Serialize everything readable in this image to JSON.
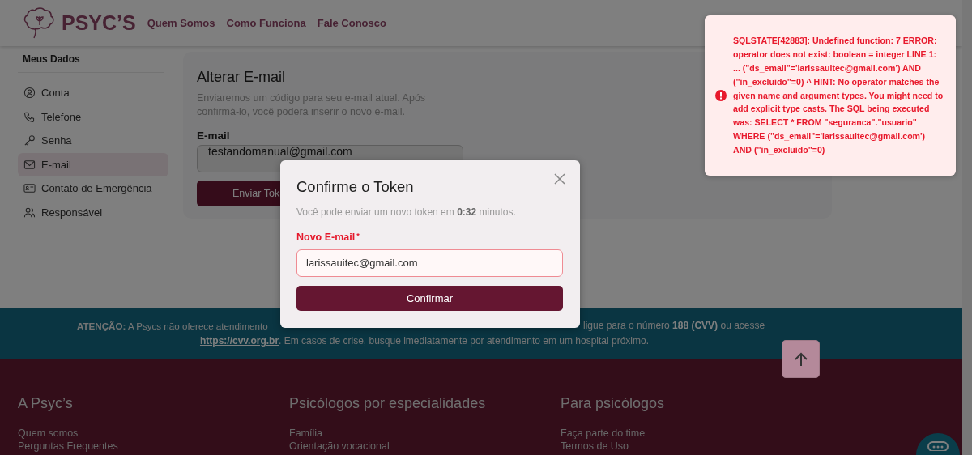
{
  "header": {
    "logo": "PSYC’S",
    "nav": [
      "Quem Somos",
      "Como Funciona",
      "Fale Conosco"
    ]
  },
  "sidebar": {
    "title": "Meus Dados",
    "items": [
      {
        "label": "Conta",
        "selected": false
      },
      {
        "label": "Telefone",
        "selected": false
      },
      {
        "label": "Senha",
        "selected": false
      },
      {
        "label": "E-mail",
        "selected": true
      },
      {
        "label": "Contato de Emergência",
        "selected": false
      },
      {
        "label": "Responsável",
        "selected": false
      }
    ]
  },
  "card": {
    "title": "Alterar E-mail",
    "description": "Enviaremos um código para seu e-mail atual. Após confirmá-lo, você poderá inserir o novo e-mail.",
    "field_label": "E-mail",
    "field_value": "testandomanual@gmail.com",
    "button": "Enviar Tok"
  },
  "attention": {
    "lead": "**ATENÇÃO:** A Psycs não oferece atendimento",
    "tail": "ligue para o número",
    "phone_link": "188 (CVV)",
    "tail_end": "ou acesse",
    "site_link": "https://cvv.org.br",
    "rest": ". Em casos de crise, busque imediatamente por atendimento em um hospital próximo."
  },
  "footer": {
    "columns": [
      {
        "title": "A Psyc’s",
        "links": [
          "Quem somos",
          "Perguntas Frequentes"
        ]
      },
      {
        "title": "Psicólogos por especialidades",
        "links": [
          "Família",
          "Orientação vocacional"
        ]
      },
      {
        "title": "Para psicólogos",
        "links": [
          "Faça parte do time",
          "Termos de Uso"
        ]
      }
    ]
  },
  "modal": {
    "title": "Confirme o Token",
    "note": "Você pode enviar um novo token em **0:32** minutos.",
    "field_label": "Novo E-mail",
    "required_mark": "*",
    "invalid": true,
    "field_value": "larissauitec@gmail.com",
    "button": "Confirmar"
  },
  "toast": {
    "message": "SQLSTATE[42883]: Undefined function: 7 ERROR: operator does not exist: boolean = integer LINE 1: ... (\"ds_email\"='larissauitec@gmail.com') AND (\"in_excluido\"=0) ^ HINT: No operator matches the given name and argument types. You might need to add explicit type casts. The SQL being executed was: SELECT * FROM \"seguranca\".\"usuario\" WHERE (\"ds_email\"='larissauitec@gmail.com') AND (\"in_excluido\"=0)"
  }
}
